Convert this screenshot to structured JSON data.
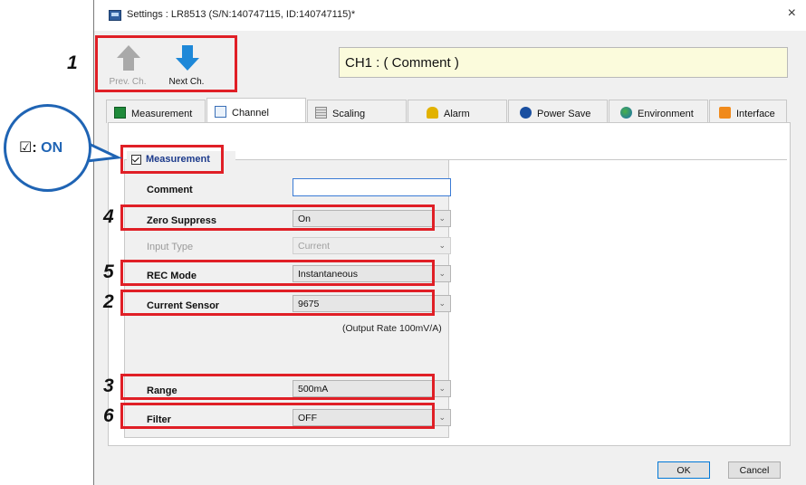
{
  "window": {
    "title": "Settings : LR8513 (S/N:140747115, ID:140747115)*",
    "close": "×"
  },
  "toolbar": {
    "prev_label": "Prev. Ch.",
    "next_label": "Next Ch.",
    "comment": "CH1 : ( Comment )"
  },
  "tabs": [
    {
      "label": "Measurement",
      "icon": "measurement-icon"
    },
    {
      "label": "Channel",
      "icon": "channel-icon",
      "active": true
    },
    {
      "label": "Scaling",
      "icon": "scaling-icon"
    },
    {
      "label": "Alarm",
      "icon": "bell-icon"
    },
    {
      "label": "Power Save",
      "icon": "bluetooth-icon"
    },
    {
      "label": "Environment",
      "icon": "globe-icon"
    },
    {
      "label": "Interface",
      "icon": "rss-icon"
    }
  ],
  "channel": {
    "measurement_label": "Measurement",
    "measurement_checked": true,
    "comment_label": "Comment",
    "comment_value": "",
    "zero_suppress_label": "Zero Suppress",
    "zero_suppress_value": "On",
    "input_type_label": "Input Type",
    "input_type_value": "Current",
    "rec_mode_label": "REC Mode",
    "rec_mode_value": "Instantaneous",
    "current_sensor_label": "Current Sensor",
    "current_sensor_value": "9675",
    "output_rate_note": "(Output Rate 100mV/A)",
    "range_label": "Range",
    "range_value": "500mA",
    "filter_label": "Filter",
    "filter_value": "OFF"
  },
  "buttons": {
    "ok": "OK",
    "cancel": "Cancel"
  },
  "callouts": {
    "n1": "1",
    "n2": "2",
    "n3": "3",
    "n4": "4",
    "n5": "5",
    "n6": "6",
    "bubble_prefix": "☑: ",
    "bubble_on": "ON"
  },
  "colors": {
    "callout_red": "#e01f26",
    "callout_blue": "#1f64b4",
    "comment_bg": "#fbfbdc",
    "arrow_blue": "#1e88d8"
  }
}
